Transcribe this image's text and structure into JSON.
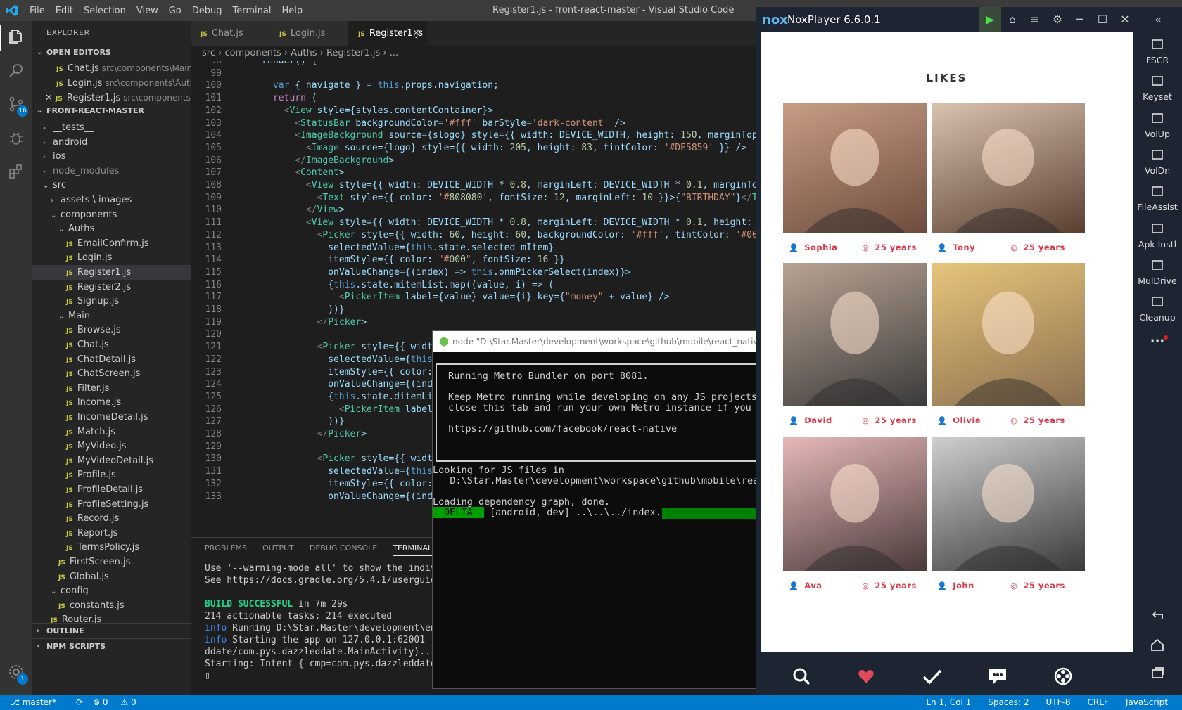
{
  "vscode": {
    "menus": [
      "File",
      "Edit",
      "Selection",
      "View",
      "Go",
      "Debug",
      "Terminal",
      "Help"
    ],
    "window_title": "Register1.js - front-react-master - Visual Studio Code",
    "scm_badge": "16",
    "settings_badge": "1"
  },
  "sidebar": {
    "title": "EXPLORER",
    "open_editors_label": "OPEN EDITORS",
    "open_editors": [
      {
        "name": "Chat.js",
        "path": "src\\components\\Main"
      },
      {
        "name": "Login.js",
        "path": "src\\components\\Auths"
      },
      {
        "name": "Register1.js",
        "path": "src\\components\\..."
      }
    ],
    "project_label": "FRONT-REACT-MASTER",
    "tree": [
      {
        "label": "__tests__",
        "type": "folder",
        "depth": 1,
        "open": false
      },
      {
        "label": "android",
        "type": "folder",
        "depth": 1,
        "open": false
      },
      {
        "label": "ios",
        "type": "folder",
        "depth": 1,
        "open": false
      },
      {
        "label": "node_modules",
        "type": "folder",
        "depth": 1,
        "open": false,
        "dim": true
      },
      {
        "label": "src",
        "type": "folder",
        "depth": 1,
        "open": true
      },
      {
        "label": "assets \\ images",
        "type": "folder",
        "depth": 2,
        "open": false
      },
      {
        "label": "components",
        "type": "folder",
        "depth": 2,
        "open": true
      },
      {
        "label": "Auths",
        "type": "folder",
        "depth": 3,
        "open": true
      },
      {
        "label": "EmailConfirm.js",
        "type": "file",
        "depth": 4
      },
      {
        "label": "Login.js",
        "type": "file",
        "depth": 4
      },
      {
        "label": "Register1.js",
        "type": "file",
        "depth": 4,
        "selected": true
      },
      {
        "label": "Register2.js",
        "type": "file",
        "depth": 4
      },
      {
        "label": "Signup.js",
        "type": "file",
        "depth": 4
      },
      {
        "label": "Main",
        "type": "folder",
        "depth": 3,
        "open": true
      },
      {
        "label": "Browse.js",
        "type": "file",
        "depth": 4
      },
      {
        "label": "Chat.js",
        "type": "file",
        "depth": 4
      },
      {
        "label": "ChatDetail.js",
        "type": "file",
        "depth": 4
      },
      {
        "label": "ChatScreen.js",
        "type": "file",
        "depth": 4
      },
      {
        "label": "Filter.js",
        "type": "file",
        "depth": 4
      },
      {
        "label": "Income.js",
        "type": "file",
        "depth": 4
      },
      {
        "label": "IncomeDetail.js",
        "type": "file",
        "depth": 4
      },
      {
        "label": "Match.js",
        "type": "file",
        "depth": 4
      },
      {
        "label": "MyVideo.js",
        "type": "file",
        "depth": 4
      },
      {
        "label": "MyVideoDetail.js",
        "type": "file",
        "depth": 4
      },
      {
        "label": "Profile.js",
        "type": "file",
        "depth": 4
      },
      {
        "label": "ProfileDetail.js",
        "type": "file",
        "depth": 4
      },
      {
        "label": "ProfileSetting.js",
        "type": "file",
        "depth": 4
      },
      {
        "label": "Record.js",
        "type": "file",
        "depth": 4
      },
      {
        "label": "Report.js",
        "type": "file",
        "depth": 4
      },
      {
        "label": "TermsPolicy.js",
        "type": "file",
        "depth": 4
      },
      {
        "label": "FirstScreen.js",
        "type": "file",
        "depth": 3
      },
      {
        "label": "Global.js",
        "type": "file",
        "depth": 3
      },
      {
        "label": "config",
        "type": "folder",
        "depth": 2,
        "open": true
      },
      {
        "label": "constants.js",
        "type": "file",
        "depth": 3
      },
      {
        "label": "Router.js",
        "type": "file",
        "depth": 2
      }
    ],
    "outline_label": "OUTLINE",
    "npm_label": "NPM SCRIPTS"
  },
  "tabs": [
    {
      "label": "Chat.js",
      "active": false
    },
    {
      "label": "Login.js",
      "active": false
    },
    {
      "label": "Register1.js",
      "active": true
    }
  ],
  "breadcrumb": [
    "src",
    "components",
    "Auths",
    "Register1.js",
    "..."
  ],
  "code_lines": [
    {
      "n": "98",
      "t": "    render() {"
    },
    {
      "n": "99",
      "t": ""
    },
    {
      "n": "100",
      "t": "      var { navigate } = this.props.navigation;"
    },
    {
      "n": "101",
      "t": "      return ("
    },
    {
      "n": "102",
      "t": "        <View style={styles.contentContainer}>"
    },
    {
      "n": "103",
      "t": "          <StatusBar backgroundColor='#fff' barStyle='dark-content' />"
    },
    {
      "n": "104",
      "t": "          <ImageBackground source={slogo} style={{ width: DEVICE_WIDTH, height: 150, marginTop: P"
    },
    {
      "n": "105",
      "t": "            <Image source={logo} style={{ width: 205, height: 83, tintColor: '#DE5859' }} />"
    },
    {
      "n": "106",
      "t": "          </ImageBackground>"
    },
    {
      "n": "107",
      "t": "          <Content>"
    },
    {
      "n": "108",
      "t": "            <View style={{ width: DEVICE_WIDTH * 0.8, marginLeft: DEVICE_WIDTH * 0.1, marginTop: !"
    },
    {
      "n": "109",
      "t": "              <Text style={{ color: '#808080', fontSize: 12, marginLeft: 10 }}>{\"BIRTHDAY\"}</Text"
    },
    {
      "n": "110",
      "t": "            </View>"
    },
    {
      "n": "111",
      "t": "            <View style={{ width: DEVICE_WIDTH * 0.8, marginLeft: DEVICE_WIDTH * 0.1, height: 60,"
    },
    {
      "n": "112",
      "t": "              <Picker style={{ width: 60, height: 60, backgroundColor: '#fff', tintColor: '#00f' }"
    },
    {
      "n": "113",
      "t": "                selectedValue={this.state.selected_mItem}"
    },
    {
      "n": "114",
      "t": "                itemStyle={{ color: \"#000\", fontSize: 16 }}"
    },
    {
      "n": "115",
      "t": "                onValueChange={(index) => this.onmPickerSelect(index)}>"
    },
    {
      "n": "116",
      "t": "                {this.state.mitemList.map((value, i) => ("
    },
    {
      "n": "117",
      "t": "                  <PickerItem label={value} value={i} key={\"money\" + value} />"
    },
    {
      "n": "118",
      "t": "                ))}"
    },
    {
      "n": "119",
      "t": "              </Picker>"
    },
    {
      "n": "120",
      "t": ""
    },
    {
      "n": "121",
      "t": "              <Picker style={{ width:"
    },
    {
      "n": "122",
      "t": "                selectedValue={this.st"
    },
    {
      "n": "123",
      "t": "                itemStyle={{ color: \"#"
    },
    {
      "n": "124",
      "t": "                onValueChange={(index)"
    },
    {
      "n": "125",
      "t": "                {this.state.ditemList."
    },
    {
      "n": "126",
      "t": "                  <PickerItem label={v"
    },
    {
      "n": "127",
      "t": "                ))}"
    },
    {
      "n": "128",
      "t": "              </Picker>"
    },
    {
      "n": "129",
      "t": ""
    },
    {
      "n": "130",
      "t": "              <Picker style={{ width:"
    },
    {
      "n": "131",
      "t": "                selectedValue={this.st"
    },
    {
      "n": "132",
      "t": "                itemStyle={{ color: \"#"
    },
    {
      "n": "133",
      "t": "                onValueChange={(index)"
    }
  ],
  "panel": {
    "tabs": [
      "PROBLEMS",
      "OUTPUT",
      "DEBUG CONSOLE",
      "TERMINAL"
    ],
    "active_tab": "TERMINAL",
    "lines": [
      "Use '--warning-mode all' to show the individua",
      "See https://docs.gradle.org/5.4.1/userguide/co",
      "",
      "BUILD SUCCESSFUL in 7m 29s",
      "214 actionable tasks: 214 executed",
      "info Running D:\\Star.Master\\development\\envire",
      "info Starting the app on 127.0.0.1:62001 (D:\\S",
      "ddate/com.pys.dazzleddate.MainActivity)...",
      "Starting: Intent { cmp=com.pys.dazzleddate/.Ma",
      "▯"
    ]
  },
  "console": {
    "title": "node  \"D:\\Star.Master\\development\\workspace\\github\\mobile\\react_native\\Dazz",
    "box_lines": [
      "Running Metro Bundler on port 8081.",
      "",
      "Keep Metro running while developing on any JS projects",
      "close this tab and run your own Metro instance if you p",
      "",
      "https://github.com/facebook/react-native"
    ],
    "after": [
      "Looking for JS files in",
      "   D:\\Star.Master\\development\\workspace\\github\\mobile\\rea",
      "",
      "Loading dependency graph, done."
    ],
    "delta_label": " DELTA ",
    "delta_text": " [android, dev] ..\\..\\../index.js "
  },
  "nox": {
    "logo": "nox",
    "title": "NoxPlayer 6.6.0.1",
    "sidebar": [
      "FSCR",
      "Keyset",
      "VolUp",
      "VolDn",
      "FileAssist",
      "Apk Instl",
      "MulDrive",
      "Cleanup",
      "..."
    ],
    "app": {
      "title": "LIKES",
      "profiles": [
        {
          "name": "Sophia",
          "age": "25 years"
        },
        {
          "name": "Tony",
          "age": "25 years"
        },
        {
          "name": "David",
          "age": "25 years"
        },
        {
          "name": "Olivia",
          "age": "25 years"
        },
        {
          "name": "Ava",
          "age": "25 years"
        },
        {
          "name": "John",
          "age": "25 years"
        }
      ],
      "nav": [
        {
          "label": "BROWSE",
          "icon": "search-icon",
          "active": false
        },
        {
          "label": "INCOMING",
          "icon": "hearts-icon",
          "active": true
        },
        {
          "label": "MATCH",
          "icon": "check-icon",
          "active": false
        },
        {
          "label": "Chat",
          "icon": "chat-bubble-icon",
          "active": false
        },
        {
          "label": "MY VIDEO",
          "icon": "video-reel-icon",
          "active": false
        }
      ]
    }
  },
  "statusbar": {
    "branch": "master*",
    "errors": "0",
    "warnings": "0",
    "right": [
      "Ln 1, Col 1",
      "Spaces: 2",
      "UTF-8",
      "CRLF",
      "JavaScript"
    ]
  }
}
